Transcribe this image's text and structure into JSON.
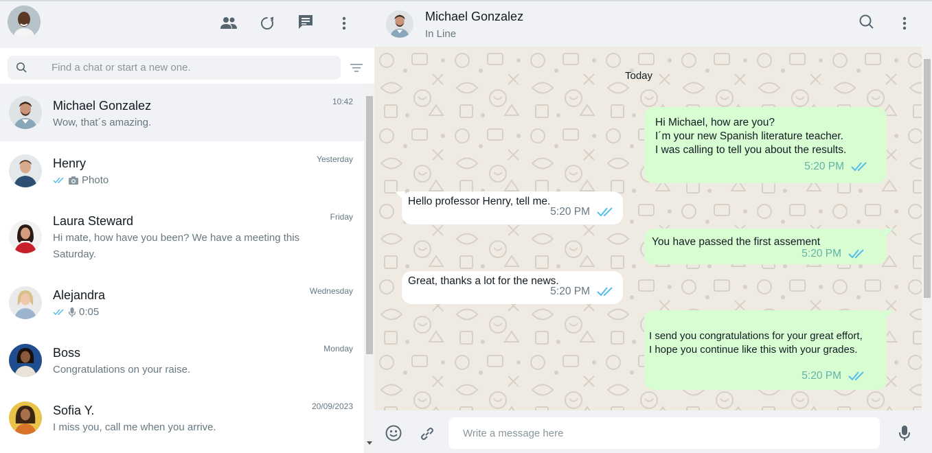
{
  "left_header": {
    "icons": [
      "communities-icon",
      "status-icon",
      "new-chat-icon",
      "menu-icon"
    ]
  },
  "search": {
    "placeholder": "Find a chat or start a new one."
  },
  "chats": [
    {
      "name": "Michael Gonzalez",
      "time": "10:42",
      "preview": "Wow, that´s amazing.",
      "active": true
    },
    {
      "name": "Henry",
      "time": "Yesterday",
      "preview": "Photo",
      "preview_type": "photo",
      "read": true
    },
    {
      "name": "Laura Steward",
      "time": "Friday",
      "preview": "Hi mate, how have you been? We have a meeting this Saturday."
    },
    {
      "name": "Alejandra",
      "time": "Wednesday",
      "preview": "0:05",
      "preview_type": "voice",
      "read": true
    },
    {
      "name": "Boss",
      "time": "Monday",
      "preview": "Congratulations on your raise."
    },
    {
      "name": "Sofia Y.",
      "time": "20/09/2023",
      "preview": "I miss you, call me when you arrive."
    }
  ],
  "conversation": {
    "contact_name": "Michael Gonzalez",
    "contact_status": "In Line",
    "date_label": "Today",
    "messages": [
      {
        "direction": "out",
        "lines": [
          "Hi Michael, how are you?",
          "I´m your new Spanish literature teacher.",
          "I was calling to tell you about the results."
        ],
        "time": "5:20 PM",
        "read": true
      },
      {
        "direction": "in",
        "lines": [
          "Hello professor Henry, tell me."
        ],
        "time": "5:20 PM",
        "read": true
      },
      {
        "direction": "out",
        "lines": [
          "You have passed the first assement"
        ],
        "time": "5:20 PM",
        "read": true
      },
      {
        "direction": "in",
        "lines": [
          "Great, thanks a lot for the news."
        ],
        "time": "5:20 PM",
        "read": true
      },
      {
        "direction": "out",
        "lines": [
          "I send you congratulations for your great effort,",
          "I hope you continue like this with your grades."
        ],
        "time": "5:20 PM",
        "read": true
      }
    ]
  },
  "composer": {
    "placeholder": "Write a message here"
  },
  "colors": {
    "outgoing_bubble": "#d9fdd3",
    "incoming_bubble": "#ffffff",
    "read_tick": "#53bdeb",
    "panel_bg": "#f0f2f5"
  }
}
